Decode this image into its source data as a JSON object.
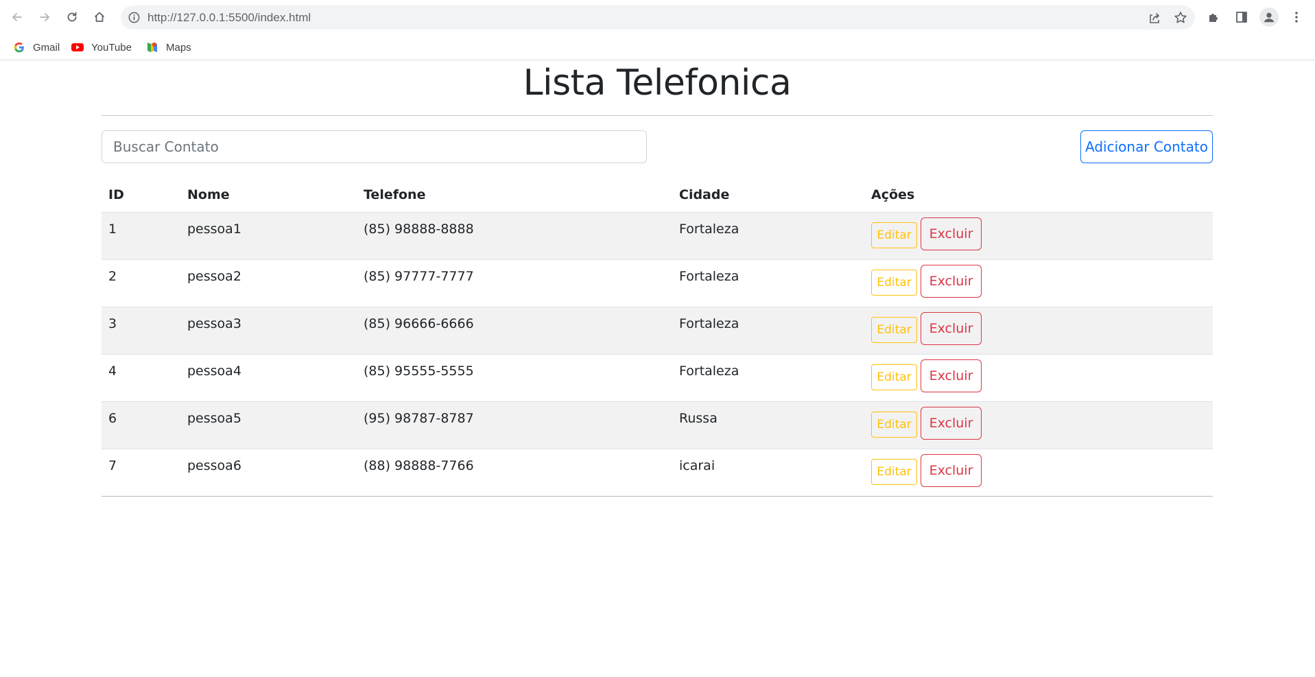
{
  "browser": {
    "url": "http://127.0.0.1:5500/index.html",
    "icons": {
      "back": "back-arrow-icon",
      "forward": "forward-arrow-icon",
      "reload": "reload-icon",
      "home": "home-icon",
      "site_info": "info-icon",
      "share": "share-icon",
      "bookmark_star": "star-icon",
      "extensions": "puzzle-icon",
      "side_panel": "side-panel-icon",
      "profile": "avatar-icon",
      "menu": "kebab-menu-icon"
    },
    "bookmarks": [
      {
        "label": "Gmail",
        "icon": "google-g-icon"
      },
      {
        "label": "YouTube",
        "icon": "youtube-icon"
      },
      {
        "label": "Maps",
        "icon": "maps-pin-icon"
      }
    ]
  },
  "page": {
    "title": "Lista Telefonica",
    "search": {
      "placeholder": "Buscar Contato",
      "value": ""
    },
    "add_button": "Adicionar Contato",
    "table": {
      "headers": {
        "id": "ID",
        "nome": "Nome",
        "telefone": "Telefone",
        "cidade": "Cidade",
        "acoes": "Ações"
      },
      "edit_label": "Editar",
      "delete_label": "Excluir",
      "rows": [
        {
          "id": "1",
          "nome": "pessoa1",
          "telefone": "(85) 98888-8888",
          "cidade": "Fortaleza"
        },
        {
          "id": "2",
          "nome": "pessoa2",
          "telefone": "(85) 97777-7777",
          "cidade": "Fortaleza"
        },
        {
          "id": "3",
          "nome": "pessoa3",
          "telefone": "(85) 96666-6666",
          "cidade": "Fortaleza"
        },
        {
          "id": "4",
          "nome": "pessoa4",
          "telefone": "(85) 95555-5555",
          "cidade": "Fortaleza"
        },
        {
          "id": "6",
          "nome": "pessoa5",
          "telefone": "(95) 98787-8787",
          "cidade": "Russa"
        },
        {
          "id": "7",
          "nome": "pessoa6",
          "telefone": "(88) 98888-7766",
          "cidade": "icarai"
        }
      ]
    }
  },
  "colors": {
    "primary": "#0d6efd",
    "warning": "#ffc107",
    "danger": "#dc3545",
    "stripe": "#f2f2f2"
  }
}
